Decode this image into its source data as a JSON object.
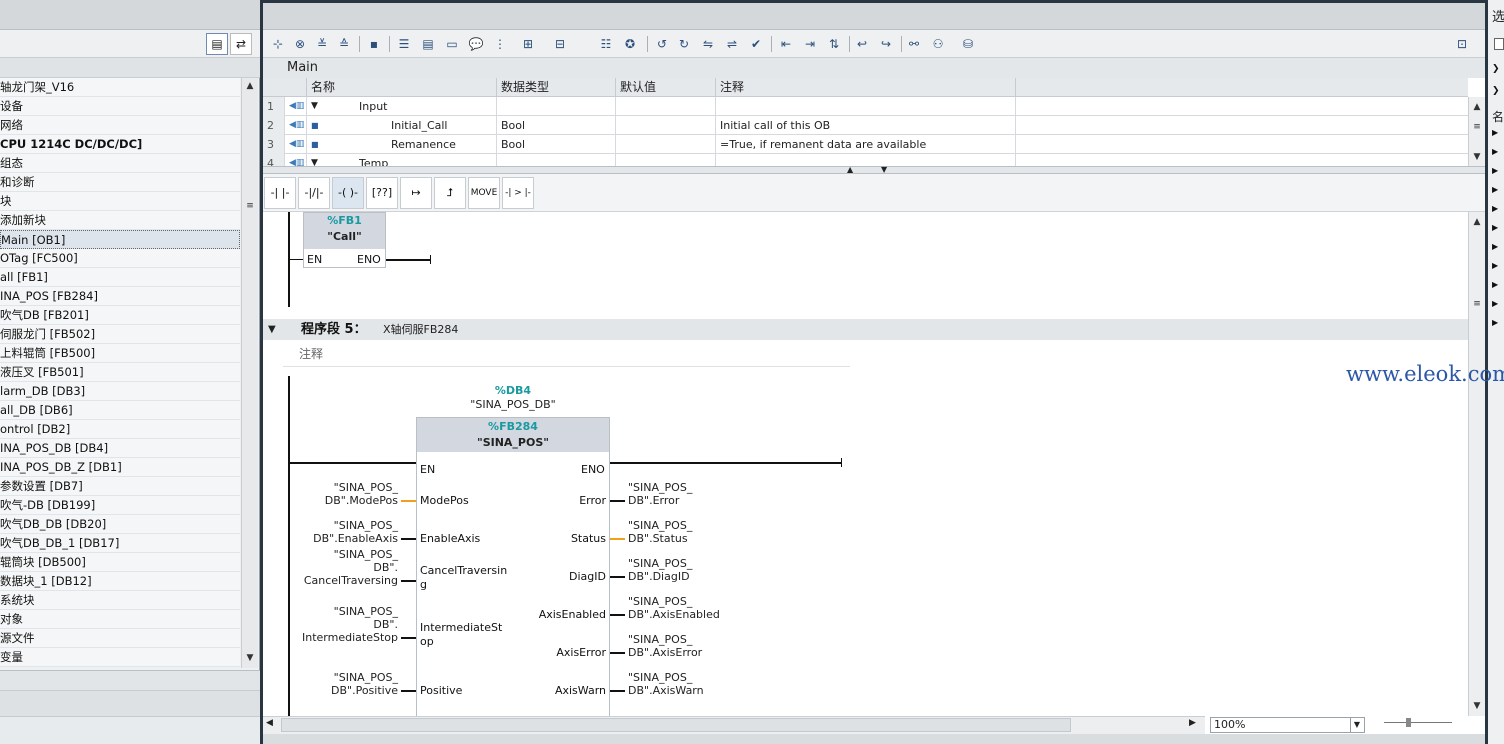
{
  "project_tree": {
    "items": [
      {
        "label": "轴龙门架_V16",
        "bold": false,
        "selected": false
      },
      {
        "label": "设备",
        "bold": false,
        "selected": false
      },
      {
        "label": "网络",
        "bold": false,
        "selected": false
      },
      {
        "label": "CPU 1214C DC/DC/DC]",
        "bold": true,
        "selected": false
      },
      {
        "label": "组态",
        "bold": false,
        "selected": false
      },
      {
        "label": "和诊断",
        "bold": false,
        "selected": false
      },
      {
        "label": "块",
        "bold": false,
        "selected": false
      },
      {
        "label": "添加新块",
        "bold": false,
        "selected": false
      },
      {
        "label": "Main [OB1]",
        "bold": false,
        "selected": true
      },
      {
        "label": "OTag [FC500]",
        "bold": false,
        "selected": false
      },
      {
        "label": "all [FB1]",
        "bold": false,
        "selected": false
      },
      {
        "label": "INA_POS [FB284]",
        "bold": false,
        "selected": false
      },
      {
        "label": "吹气DB [FB201]",
        "bold": false,
        "selected": false
      },
      {
        "label": "伺服龙门 [FB502]",
        "bold": false,
        "selected": false
      },
      {
        "label": "上料辊筒 [FB500]",
        "bold": false,
        "selected": false
      },
      {
        "label": "液压叉 [FB501]",
        "bold": false,
        "selected": false
      },
      {
        "label": "larm_DB [DB3]",
        "bold": false,
        "selected": false
      },
      {
        "label": "all_DB [DB6]",
        "bold": false,
        "selected": false
      },
      {
        "label": "ontrol [DB2]",
        "bold": false,
        "selected": false
      },
      {
        "label": "INA_POS_DB [DB4]",
        "bold": false,
        "selected": false
      },
      {
        "label": "INA_POS_DB_Z [DB1]",
        "bold": false,
        "selected": false
      },
      {
        "label": "参数设置 [DB7]",
        "bold": false,
        "selected": false
      },
      {
        "label": "吹气-DB [DB199]",
        "bold": false,
        "selected": false
      },
      {
        "label": "吹气DB_DB [DB20]",
        "bold": false,
        "selected": false
      },
      {
        "label": "吹气DB_DB_1 [DB17]",
        "bold": false,
        "selected": false
      },
      {
        "label": "辊筒块 [DB500]",
        "bold": false,
        "selected": false
      },
      {
        "label": "数据块_1 [DB12]",
        "bold": false,
        "selected": false
      },
      {
        "label": "系统块",
        "bold": false,
        "selected": false
      },
      {
        "label": "对象",
        "bold": false,
        "selected": false
      },
      {
        "label": "源文件",
        "bold": false,
        "selected": false
      },
      {
        "label": "变量",
        "bold": false,
        "selected": false
      }
    ]
  },
  "editor": {
    "block_title": "Main",
    "interface": {
      "headers": [
        "名称",
        "数据类型",
        "默认值",
        "注释"
      ],
      "rows": [
        {
          "num": "1",
          "name": "Input",
          "type": "",
          "default": "",
          "comment": "",
          "group": true
        },
        {
          "num": "2",
          "name": "Initial_Call",
          "type": "Bool",
          "default": "",
          "comment": "Initial call of this OB",
          "group": false
        },
        {
          "num": "3",
          "name": "Remanence",
          "type": "Bool",
          "default": "",
          "comment": "=True, if remanent data are available",
          "group": false
        },
        {
          "num": "4",
          "name": "Temp",
          "type": "",
          "default": "",
          "comment": "",
          "group": true
        }
      ]
    },
    "lad_toolbar": [
      "-| |-",
      "-|/|-",
      "-( )-",
      "[??]",
      "↦",
      "⮥",
      "MOVE",
      "-| > |-"
    ],
    "network4_block": {
      "address": "%FB1",
      "name": "\"Call\"",
      "en": "EN",
      "eno": "ENO"
    },
    "network5": {
      "title": "程序段 5：",
      "subtitle": "X轴伺服FB284",
      "comment": "注释",
      "instance_db": "%DB4",
      "instance_db_name": "\"SINA_POS_DB\"",
      "block_address": "%FB284",
      "block_name": "\"SINA_POS\"",
      "en": "EN",
      "eno": "ENO",
      "inputs": [
        {
          "pin": "ModePos",
          "operand": "\"SINA_POS_\n DB\".ModePos"
        },
        {
          "pin": "EnableAxis",
          "operand": "\"SINA_POS_\nDB\".EnableAxis"
        },
        {
          "pin": "CancelTraversin\ng",
          "operand": "\"SINA_POS_\n DB\".\nCancelTraversing"
        },
        {
          "pin": "IntermediateSt\nop",
          "operand": "\"SINA_POS_\n DB\".\nIntermediateStop"
        },
        {
          "pin": "Positive",
          "operand": "\"SINA_POS_\nDB\".Positive"
        },
        {
          "pin": "",
          "operand": "\"SINA_POS_"
        }
      ],
      "outputs": [
        {
          "pin": "Error",
          "operand": "\"SINA_POS_\nDB\".Error"
        },
        {
          "pin": "Status",
          "operand": "\"SINA_POS_\nDB\".Status"
        },
        {
          "pin": "DiagID",
          "operand": "\"SINA_POS_\nDB\".DiagID"
        },
        {
          "pin": "AxisEnabled",
          "operand": "\"SINA_POS_\nDB\".AxisEnabled"
        },
        {
          "pin": "AxisError",
          "operand": "\"SINA_POS_\nDB\".AxisError"
        },
        {
          "pin": "AxisWarn",
          "operand": "\"SINA_POS_\nDB\".AxisWarn"
        },
        {
          "pin": "",
          "operand": "\"SINA_POS_"
        }
      ]
    },
    "zoom": "100%"
  },
  "right_pane": {
    "header": "选",
    "sub": "名"
  },
  "watermark": "www.eleok.com",
  "colors": {
    "accent_orange": "#f2a01c",
    "teal": "#1a9aa0",
    "watermark": "#2b57a7"
  }
}
